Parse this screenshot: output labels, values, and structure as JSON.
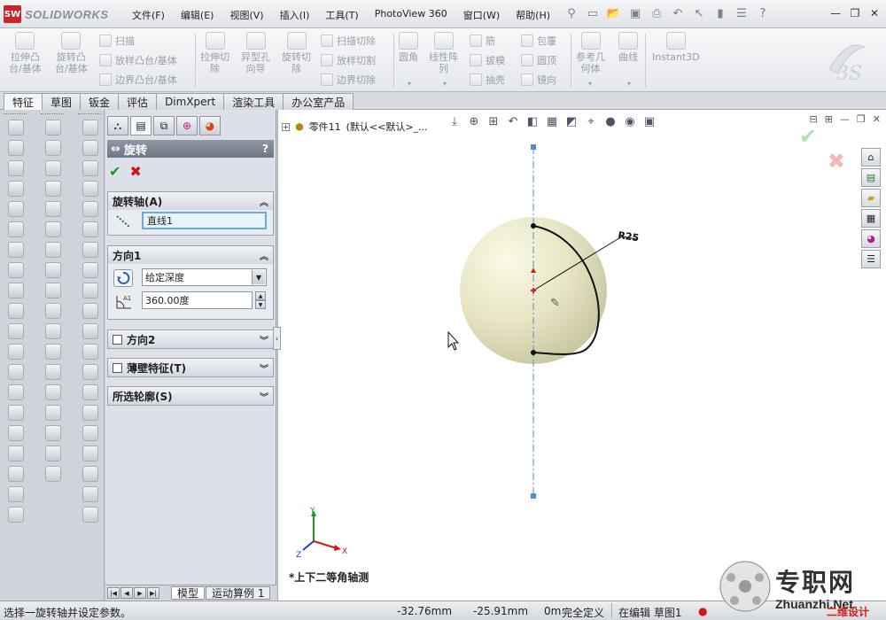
{
  "app": {
    "logo_text": "SOLIDWORKS",
    "logo_badge": "SW"
  },
  "menu": [
    "文件(F)",
    "编辑(E)",
    "视图(V)",
    "插入(I)",
    "工具(T)",
    "PhotoView 360",
    "窗口(W)",
    "帮助(H)"
  ],
  "ribbon": {
    "extrude_boss": "拉伸凸\n台/基体",
    "revolve_boss": "旋转凸\n台/基体",
    "sweep": "扫描",
    "loft_boss": "放样凸台/基体",
    "boundary_boss": "边界凸台/基体",
    "extrude_cut": "拉伸切\n除",
    "hole_wizard": "异型孔\n向导",
    "revolve_cut": "旋转切\n除",
    "sweep_cut": "扫描切除",
    "loft_cut": "放样切割",
    "boundary_cut": "边界切除",
    "fillet": "圆角",
    "linear_pattern": "线性阵\n列",
    "rib": "筋",
    "draft": "拔模",
    "shell": "抽壳",
    "wrap": "包覆",
    "dome": "圆顶",
    "mirror": "镜向",
    "ref_geometry": "参考几\n何体",
    "curves": "曲线",
    "instant3d": "Instant3D"
  },
  "tabs": [
    "特征",
    "草图",
    "钣金",
    "评估",
    "DimXpert",
    "渲染工具",
    "办公室产品"
  ],
  "active_tab": 0,
  "property_manager": {
    "title": "旋转",
    "help": "?",
    "axis_group": {
      "title": "旋转轴(A)",
      "value": "直线1"
    },
    "direction1_group": {
      "title": "方向1",
      "end_condition": "给定深度",
      "angle": "360.00度",
      "angle_icon_label": "A1"
    },
    "direction2_group": {
      "title": "方向2"
    },
    "thin_group": {
      "title": "薄壁特征(T)"
    },
    "contours_group": {
      "title": "所选轮廓(S)"
    }
  },
  "bottom_tabs": [
    "模型",
    "运动算例 1"
  ],
  "graphics": {
    "tree_item": "零件11",
    "tree_config": "(默认<<默认>_...",
    "dimension_label": "R25",
    "view_name": "*上下二等角轴测",
    "triad": {
      "x": "X",
      "y": "Y",
      "z": "Z"
    },
    "colors": {
      "sphere_light": "#fbfbe6",
      "sphere_dark": "#c9c6a2",
      "axis_line": "#4a8fd0",
      "sketch": "#111111"
    }
  },
  "status": {
    "message": "选择一旋转轴并设定参数。",
    "x": "-32.76mm",
    "y": "-25.91mm",
    "z": "0m",
    "state": "完全定义",
    "editing": "在编辑 草图1"
  },
  "watermark": {
    "chinese": "专职网",
    "url": "Zhuanzhi.Net",
    "red_text": "二维设计"
  }
}
